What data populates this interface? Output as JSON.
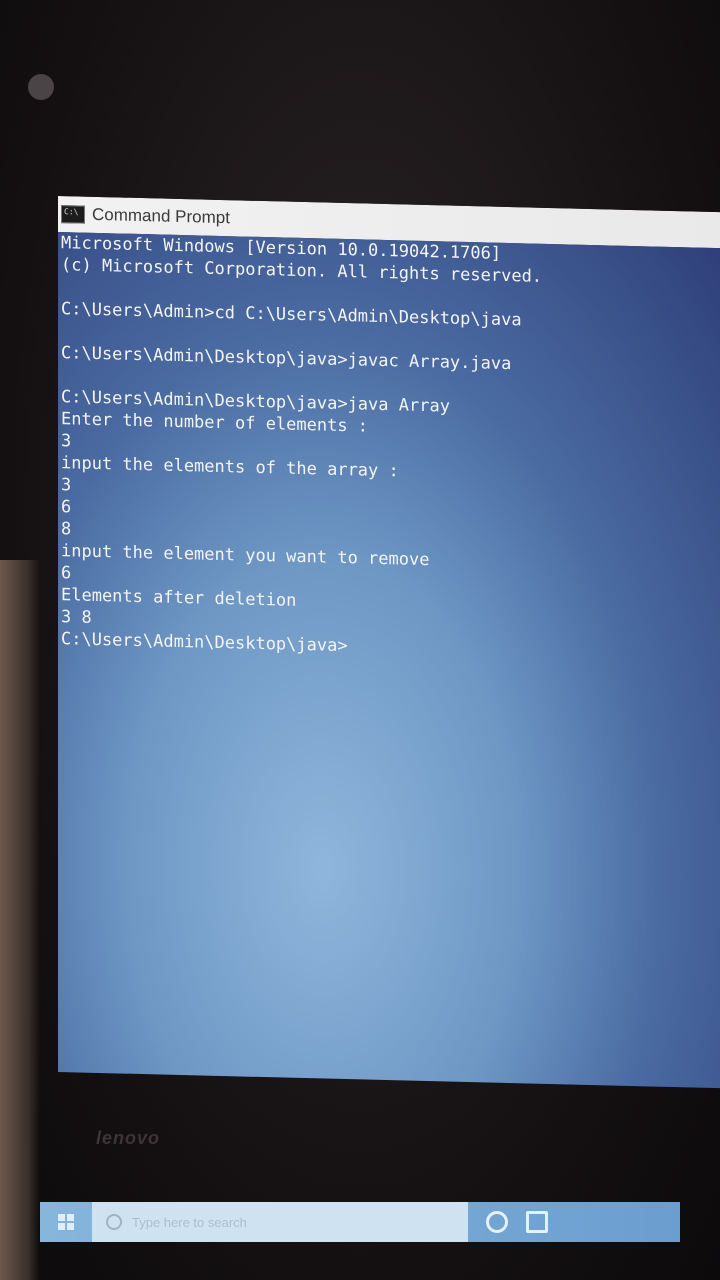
{
  "window": {
    "title": "Command Prompt"
  },
  "console": {
    "lines": [
      "Microsoft Windows [Version 10.0.19042.1706]",
      "(c) Microsoft Corporation. All rights reserved.",
      "",
      "C:\\Users\\Admin>cd C:\\Users\\Admin\\Desktop\\java",
      "",
      "C:\\Users\\Admin\\Desktop\\java>javac Array.java",
      "",
      "C:\\Users\\Admin\\Desktop\\java>java Array",
      "Enter the number of elements :",
      "3",
      "input the elements of the array :",
      "3",
      "6",
      "8",
      "input the element you want to remove",
      "6",
      "Elements after deletion",
      "3 8",
      "C:\\Users\\Admin\\Desktop\\java>"
    ]
  },
  "taskbar": {
    "search_placeholder": "Type here to search"
  },
  "laptop": {
    "brand": "lenovo"
  },
  "colors": {
    "console_text": "#f4f4f4",
    "titlebar": "#f2f2f2"
  }
}
